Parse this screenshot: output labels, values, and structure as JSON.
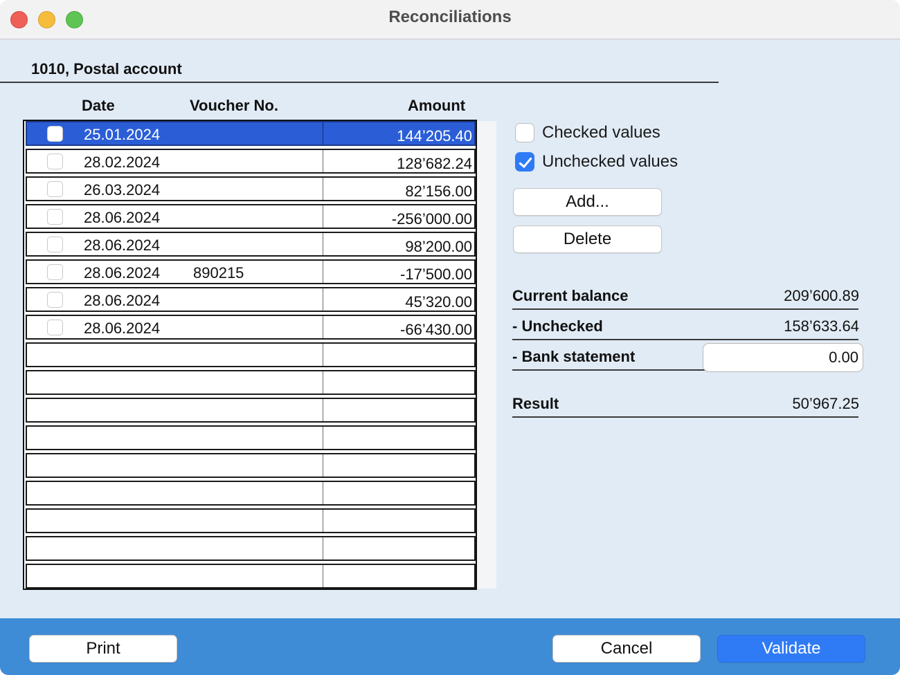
{
  "window": {
    "title": "Reconciliations"
  },
  "account": {
    "label": "1010, Postal account"
  },
  "table": {
    "headers": {
      "date": "Date",
      "voucher": "Voucher No.",
      "amount": "Amount"
    },
    "rows": [
      {
        "checked": false,
        "date": "25.01.2024",
        "voucher": "",
        "amount": "144’205.40",
        "selected": true
      },
      {
        "checked": false,
        "date": "28.02.2024",
        "voucher": "",
        "amount": "128’682.24"
      },
      {
        "checked": false,
        "date": "26.03.2024",
        "voucher": "",
        "amount": "82’156.00"
      },
      {
        "checked": false,
        "date": "28.06.2024",
        "voucher": "",
        "amount": "-256’000.00"
      },
      {
        "checked": false,
        "date": "28.06.2024",
        "voucher": "",
        "amount": "98’200.00"
      },
      {
        "checked": false,
        "date": "28.06.2024",
        "voucher": "890215",
        "amount": "-17’500.00"
      },
      {
        "checked": false,
        "date": "28.06.2024",
        "voucher": "",
        "amount": "45’320.00"
      },
      {
        "checked": false,
        "date": "28.06.2024",
        "voucher": "",
        "amount": "-66’430.00"
      }
    ]
  },
  "filters": {
    "checked_values": {
      "label": "Checked values",
      "checked": false
    },
    "unchecked_values": {
      "label": "Unchecked values",
      "checked": true
    }
  },
  "actions": {
    "add_label": "Add...",
    "delete_label": "Delete"
  },
  "summary": {
    "current_balance": {
      "label": "Current balance",
      "value": "209’600.89"
    },
    "unchecked": {
      "label": "- Unchecked",
      "value": "158’633.64"
    },
    "bank_statement": {
      "label": "- Bank statement",
      "value": "0.00"
    },
    "result": {
      "label": "Result",
      "value": "50’967.25"
    }
  },
  "footer": {
    "print_label": "Print",
    "cancel_label": "Cancel",
    "validate_label": "Validate"
  },
  "colors": {
    "accent": "#2f7bf6",
    "selection": "#2b5ed6",
    "panel_bg": "#e1ebf5",
    "footer_bg": "#3f8cd6"
  }
}
